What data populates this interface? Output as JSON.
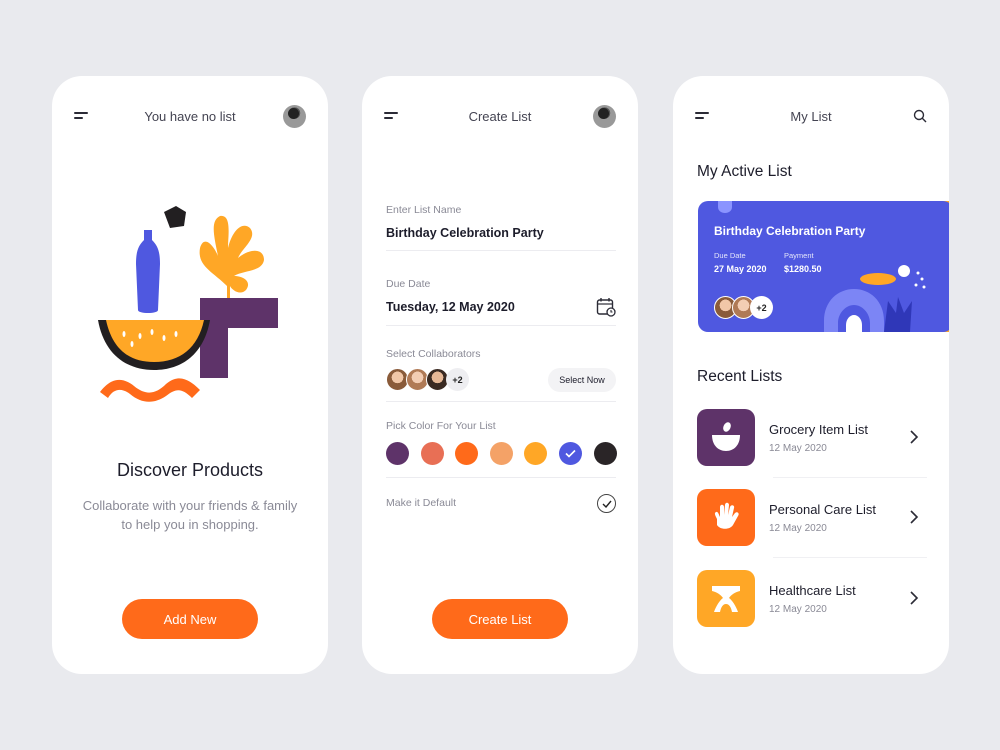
{
  "screens": {
    "empty": {
      "title": "You have no list",
      "heading": "Discover Products",
      "subtitle": "Collaborate with your friends & family to help you in shopping.",
      "button": "Add New"
    },
    "create": {
      "title": "Create List",
      "name_label": "Enter List Name",
      "name_value": "Birthday Celebration Party",
      "date_label": "Due Date",
      "date_value": "Tuesday, 12 May 2020",
      "collab_label": "Select Collaborators",
      "collab_extra": "+2",
      "select_now": "Select Now",
      "color_label": "Pick Color For Your List",
      "colors": [
        "#5e3369",
        "#e86f55",
        "#ff6a1a",
        "#f4a267",
        "#ffa726",
        "#4f58e0",
        "#2a2527"
      ],
      "selected_color_index": 5,
      "default_label": "Make it Default",
      "default_checked": true,
      "button": "Create List"
    },
    "mylist": {
      "title": "My List",
      "active_title": "My Active List",
      "active_card": {
        "title": "Birthday Celebration Party",
        "due_label": "Due Date",
        "due_value": "27 May 2020",
        "payment_label": "Payment",
        "payment_value": "$1280.50",
        "collab_extra": "+2",
        "color": "#4f58e0"
      },
      "recent_title": "Recent Lists",
      "recent": [
        {
          "title": "Grocery Item List",
          "date": "12 May 2020",
          "color": "#5e3369",
          "icon": "bowl-icon"
        },
        {
          "title": "Personal Care List",
          "date": "12 May 2020",
          "color": "#ff6a1a",
          "icon": "hand-icon"
        },
        {
          "title": "Healthcare List",
          "date": "12 May 2020",
          "color": "#ffa726",
          "icon": "hourglass-icon"
        }
      ]
    }
  }
}
